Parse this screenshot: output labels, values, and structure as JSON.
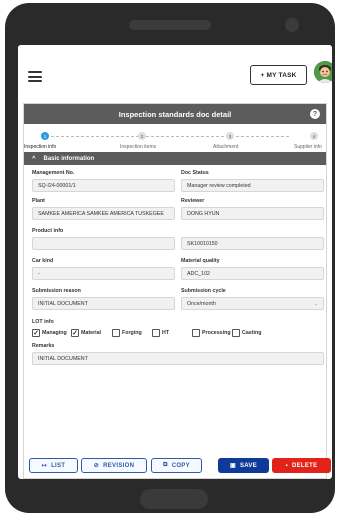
{
  "header": {
    "my_task_label": "+ MY TASK",
    "menu_icon": "hamburger-icon",
    "avatar_icon": "user-avatar"
  },
  "panel": {
    "title": "Inspection standards doc detail",
    "help_icon": "?"
  },
  "steps": [
    {
      "number": "1",
      "label": "Inspection info",
      "active": true
    },
    {
      "number": "2",
      "label": "Inspection items",
      "active": false
    },
    {
      "number": "3",
      "label": "Attachment",
      "active": false
    },
    {
      "number": "4",
      "label": "Supplier info",
      "active": false
    }
  ],
  "section": {
    "title": "Basic information",
    "chevron": "^"
  },
  "fields": {
    "management_no": {
      "label": "Management No.",
      "value": "SQ-I24-00001/1"
    },
    "doc_status": {
      "label": "Doc Status",
      "value": "Manager review completed"
    },
    "plant": {
      "label": "Plant",
      "value": "SAMKEE AMERICA SAMKEE AMERICA TUSKEGEE"
    },
    "reviewer": {
      "label": "Reviewer",
      "value": "DONG HYUN"
    },
    "product_info": {
      "label": "Product info",
      "value": "",
      "value2": "SK10010150"
    },
    "car_kind": {
      "label": "Car kind",
      "value": "-"
    },
    "material_quality": {
      "label": "Material quality",
      "value": "ADC_102"
    },
    "submission_reason": {
      "label": "Submission reason",
      "value": "INITIAL DOCUMENT"
    },
    "submission_cycle": {
      "label": "Submission cycle",
      "value": "Once/month",
      "caret": "⌄"
    },
    "lot_info": {
      "label": "LOT info",
      "options": [
        {
          "label": "Managing",
          "checked": true
        },
        {
          "label": "Material",
          "checked": true
        },
        {
          "label": "Forging",
          "checked": false
        },
        {
          "label": "HT",
          "checked": false
        },
        {
          "label": "Processing",
          "checked": false
        },
        {
          "label": "Casting",
          "checked": false
        }
      ]
    },
    "remarks": {
      "label": "Remarks",
      "value": "INITIAL DOCUMENT"
    }
  },
  "actions": {
    "list": {
      "icon": "↦",
      "label": "LIST"
    },
    "revision": {
      "icon": "⊘",
      "label": "REVISION"
    },
    "copy": {
      "icon": "⧉",
      "label": "COPY"
    },
    "save": {
      "icon": "▣",
      "label": "SAVE"
    },
    "delete": {
      "icon": "▪",
      "label": "DELETE"
    }
  },
  "colors": {
    "header_bg": "#5c5c5c",
    "active_step": "#2d9be0",
    "save_bg": "#0f3a9a",
    "delete_bg": "#e2231a",
    "outline_btn": "#2f5ba8"
  }
}
